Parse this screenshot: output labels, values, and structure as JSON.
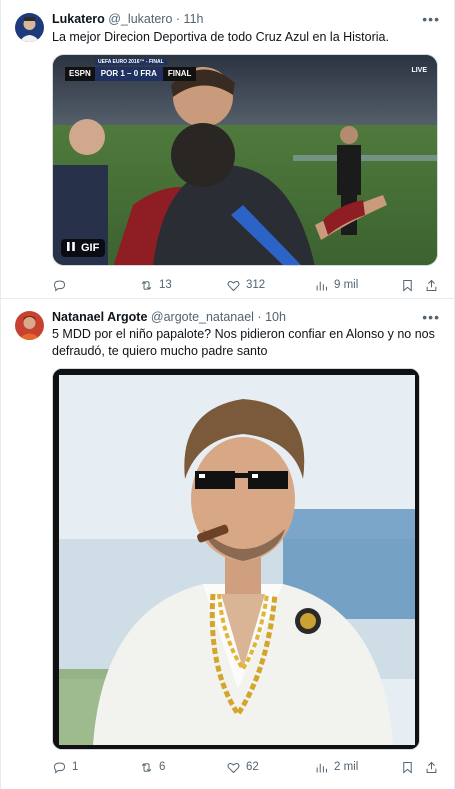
{
  "tweets": [
    {
      "display_name": "Lukatero",
      "handle": "@_lukatero",
      "separator": "·",
      "time": "11h",
      "text": "La mejor Direcion Deportiva de todo Cruz Azul en la Historia.",
      "media": {
        "scoreboard": {
          "network": "ESPN",
          "home": "POR",
          "score": "1 – 0",
          "away": "FRA",
          "status": "FINAL",
          "competition": "UEFA EURO 2016™ - FINAL"
        },
        "live_label": "LIVE",
        "badge": "GIF"
      },
      "actions": {
        "replies": "",
        "retweets": "13",
        "likes": "312",
        "views": "9 mil"
      }
    },
    {
      "display_name": "Natanael Argote",
      "handle": "@argote_natanael",
      "separator": "·",
      "time": "10h",
      "text": "5 MDD por el niño papalote? Nos pidieron confiar en Alonso y no nos defraudó, te quiero mucho padre santo",
      "actions": {
        "replies": "1",
        "retweets": "6",
        "likes": "62",
        "views": "2 mil"
      }
    }
  ],
  "colors": {
    "text": "#0f1419",
    "muted": "#536471",
    "border": "#e6ecf0"
  },
  "icons": [
    "reply-icon",
    "retweet-icon",
    "like-icon",
    "views-icon",
    "bookmark-icon",
    "share-icon",
    "more-icon",
    "pause-icon"
  ]
}
